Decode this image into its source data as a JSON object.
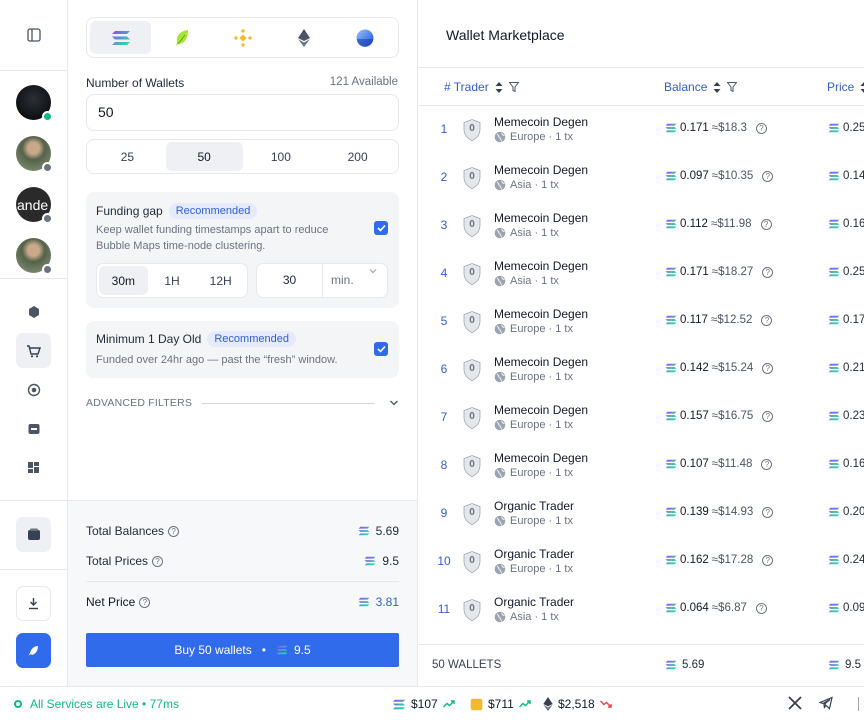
{
  "status_bar": {
    "live_text": "All Services are Live",
    "latency": "77ms",
    "tickers": [
      {
        "symbol_icon": "solana-icon",
        "price": "$107",
        "trend": "up"
      },
      {
        "symbol_icon": "bnb-icon",
        "price": "$711",
        "trend": "up"
      },
      {
        "symbol_icon": "ethereum-icon",
        "price": "$2,518",
        "trend": "down"
      }
    ]
  },
  "form": {
    "chains": [
      "solana-icon",
      "leaf-icon",
      "bnb-icon",
      "ethereum-icon",
      "base-icon"
    ],
    "wallets_label": "Number of Wallets",
    "available": "121 Available",
    "wallets_value": "50",
    "presets": [
      "25",
      "50",
      "100",
      "200"
    ],
    "funding_gap": {
      "title": "Funding gap",
      "badge": "Recommended",
      "desc": "Keep wallet funding timestamps apart to reduce Bubble Maps time-node clustering.",
      "intervals": [
        "30m",
        "1H",
        "12H"
      ],
      "value": "30",
      "unit": "min."
    },
    "min_age": {
      "title": "Minimum 1 Day Old",
      "badge": "Recommended",
      "desc": "Funded over 24hr ago — past the “fresh” window."
    },
    "advanced": "ADVANCED FILTERS"
  },
  "summary": {
    "total_balances_label": "Total Balances",
    "total_balances": "5.69",
    "total_prices_label": "Total Prices",
    "total_prices": "9.5",
    "net_price_label": "Net Price",
    "net_price": "3.81",
    "buy_label": "Buy 50 wallets",
    "buy_amount": "9.5"
  },
  "table": {
    "title": "Wallet Marketplace",
    "col_trader": "# Trader",
    "col_balance": "Balance",
    "col_price": "Price",
    "rows": [
      {
        "idx": "1",
        "level": "0",
        "name": "Memecoin Degen",
        "region": "Europe · 1 tx",
        "bal": "0.171",
        "usd": "≈$18.3",
        "price": "0.25"
      },
      {
        "idx": "2",
        "level": "0",
        "name": "Memecoin Degen",
        "region": "Asia · 1 tx",
        "bal": "0.097",
        "usd": "≈$10.35",
        "price": "0.14"
      },
      {
        "idx": "3",
        "level": "0",
        "name": "Memecoin Degen",
        "region": "Asia · 1 tx",
        "bal": "0.112",
        "usd": "≈$11.98",
        "price": "0.16"
      },
      {
        "idx": "4",
        "level": "0",
        "name": "Memecoin Degen",
        "region": "Asia · 1 tx",
        "bal": "0.171",
        "usd": "≈$18.27",
        "price": "0.25"
      },
      {
        "idx": "5",
        "level": "0",
        "name": "Memecoin Degen",
        "region": "Europe · 1 tx",
        "bal": "0.117",
        "usd": "≈$12.52",
        "price": "0.17"
      },
      {
        "idx": "6",
        "level": "0",
        "name": "Memecoin Degen",
        "region": "Europe · 1 tx",
        "bal": "0.142",
        "usd": "≈$15.24",
        "price": "0.21"
      },
      {
        "idx": "7",
        "level": "0",
        "name": "Memecoin Degen",
        "region": "Europe · 1 tx",
        "bal": "0.157",
        "usd": "≈$16.75",
        "price": "0.23"
      },
      {
        "idx": "8",
        "level": "0",
        "name": "Memecoin Degen",
        "region": "Europe · 1 tx",
        "bal": "0.107",
        "usd": "≈$11.48",
        "price": "0.16"
      },
      {
        "idx": "9",
        "level": "0",
        "name": "Organic Trader",
        "region": "Europe · 1 tx",
        "bal": "0.139",
        "usd": "≈$14.93",
        "price": "0.20"
      },
      {
        "idx": "10",
        "level": "0",
        "name": "Organic Trader",
        "region": "Europe · 1 tx",
        "bal": "0.162",
        "usd": "≈$17.28",
        "price": "0.24"
      },
      {
        "idx": "11",
        "level": "0",
        "name": "Organic Trader",
        "region": "Asia · 1 tx",
        "bal": "0.064",
        "usd": "≈$6.87",
        "price": "0.09"
      }
    ],
    "footer_count": "50 WALLETS",
    "footer_balance": "5.69",
    "footer_price": "9.5"
  },
  "rail": {
    "avatar_text": "ande"
  },
  "colors": {
    "accent": "#2f6bea",
    "live": "#10b981",
    "badge_bg": "#e5ebfb"
  }
}
